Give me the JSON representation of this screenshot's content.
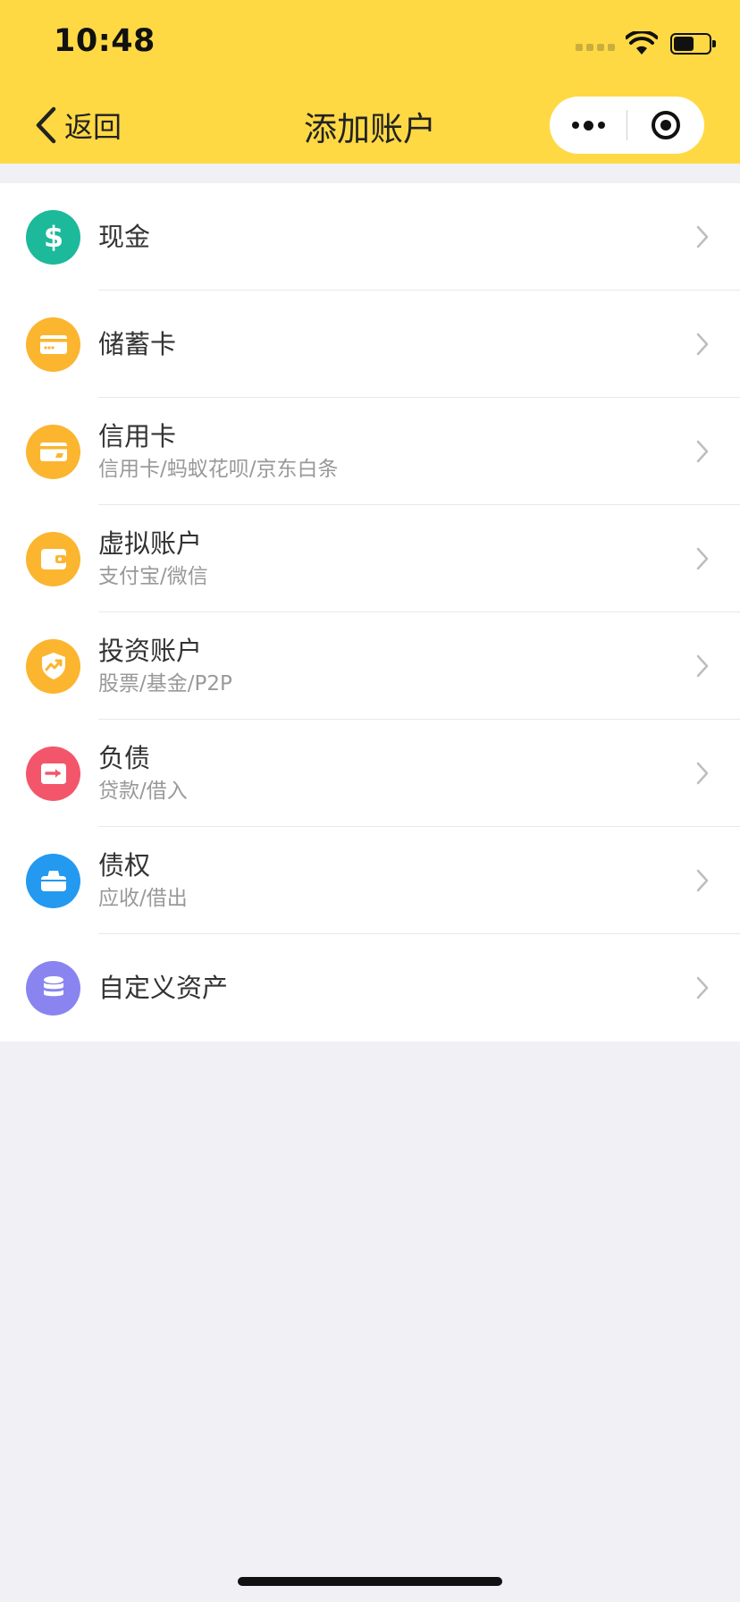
{
  "status_bar": {
    "time": "10:48"
  },
  "nav": {
    "back_label": "返回",
    "title": "添加账户"
  },
  "colors": {
    "header_bg": "#FFD944",
    "page_bg": "#F1F1F5",
    "cash": "#1CB99A",
    "gold": "#FBB52F",
    "debt": "#F3566A",
    "credit_right": "#2399F0",
    "custom": "#8A84F0"
  },
  "accounts": [
    {
      "title": "现金",
      "subtitle": "",
      "icon": "dollar-icon"
    },
    {
      "title": "储蓄卡",
      "subtitle": "",
      "icon": "debit-card-icon"
    },
    {
      "title": "信用卡",
      "subtitle": "信用卡/蚂蚁花呗/京东白条",
      "icon": "credit-card-icon"
    },
    {
      "title": "虚拟账户",
      "subtitle": "支付宝/微信",
      "icon": "wallet-icon"
    },
    {
      "title": "投资账户",
      "subtitle": "股票/基金/P2P",
      "icon": "investment-shield-icon"
    },
    {
      "title": "负债",
      "subtitle": "贷款/借入",
      "icon": "debt-icon"
    },
    {
      "title": "债权",
      "subtitle": "应收/借出",
      "icon": "receivable-icon"
    },
    {
      "title": "自定义资产",
      "subtitle": "",
      "icon": "coin-stack-icon"
    }
  ]
}
